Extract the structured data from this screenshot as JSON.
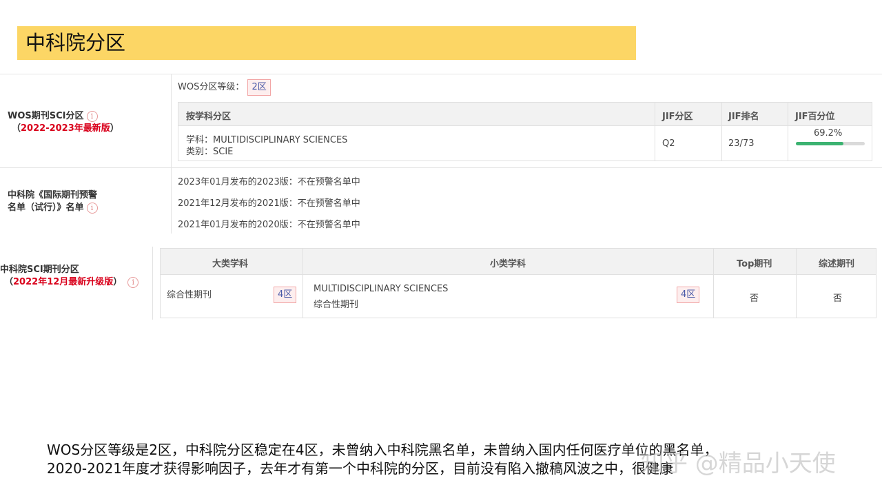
{
  "header": {
    "title": "中科院分区"
  },
  "wos": {
    "label_line1": "WOS期刊SCI分区",
    "label_edition": "2022-2023年最新版",
    "open_paren": "（",
    "close_paren": "）",
    "grade_label": "WOS分区等级：",
    "grade_value": "2区",
    "table": {
      "headers": [
        "按学科分区",
        "JIF分区",
        "JIF排名",
        "JIF百分位"
      ],
      "subject_line": "学科：MULTIDISCIPLINARY SCIENCES",
      "category_line": "类别：SCIE",
      "jif_quartile": "Q2",
      "jif_rank": "23/73",
      "jif_percentile": "69.2%",
      "jif_percentile_fraction": 0.692
    }
  },
  "cas_warning": {
    "label_line1": "中科院《国际期刊预警",
    "label_line2": "名单（试行）》名单",
    "entries": [
      "2023年01月发布的2023版：不在预警名单中",
      "2021年12月发布的2021版：不在预警名单中",
      "2021年01月发布的2020版：不在预警名单中"
    ]
  },
  "cas_partition": {
    "label_line1": "中科院SCI期刊分区",
    "label_edition": "2022年12月最新升级版",
    "open_paren": "（",
    "close_paren": "）",
    "headers": [
      "大类学科",
      "小类学科",
      "Top期刊",
      "综述期刊"
    ],
    "major_subject": "综合性期刊",
    "major_zone": "4区",
    "minor_subject_en": "MULTIDISCIPLINARY SCIENCES",
    "minor_subject_cn": "综合性期刊",
    "minor_zone": "4区",
    "top_journal": "否",
    "review_journal": "否"
  },
  "info_icon_glyph": "i",
  "summary": {
    "line1": "WOS分区等级是2区，中科院分区稳定在4区，未曾纳入中科院黑名单，未曾纳入国内任何医疗单位的黑名单，",
    "line2": "2020-2021年度才获得影响因子，去年才有第一个中科院的分区，目前没有陷入撤稿风波之中，很健康"
  },
  "watermark": "知乎 @精品小天使"
}
